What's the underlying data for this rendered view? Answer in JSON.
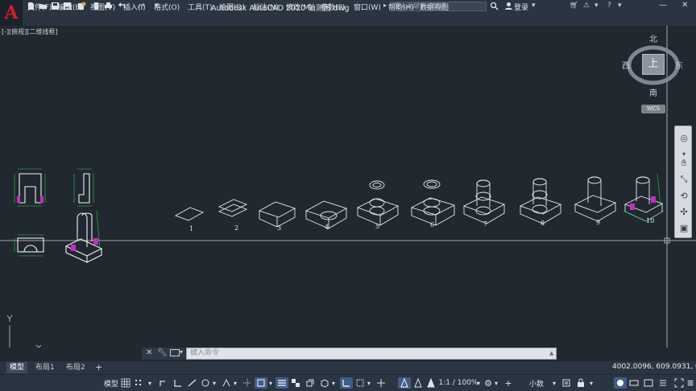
{
  "app": {
    "logo_letter": "A",
    "title": "Autodesk AutoCAD 2020    轴测图.dwg",
    "search_placeholder": "键入关键字或短语",
    "login": "登录"
  },
  "menu": [
    "文件(F)",
    "编辑(E)",
    "视图(V)",
    "插入(I)",
    "格式(O)",
    "工具(T)",
    "绘图(D)",
    "标注(N)",
    "修改(M)",
    "参数(P)",
    "窗口(W)",
    "帮助(H)",
    "数据视图"
  ],
  "viewport": {
    "label": "[-][俯视][二维线框]"
  },
  "viewcube": {
    "north": "北",
    "south": "南",
    "east": "东",
    "west": "西",
    "face": "上",
    "wcs": "WCS"
  },
  "steps": [
    "1",
    "2",
    "3",
    "4",
    "5",
    "6",
    "7",
    "8",
    "9",
    "10"
  ],
  "command": {
    "placeholder": "键入命令"
  },
  "tabs": [
    "模型",
    "布局1",
    "布局2"
  ],
  "coordinates": "4002.0096, 609.0931, 0.0000",
  "status": {
    "model": "模型",
    "scale": "1:1 / 100%",
    "units": "小数"
  },
  "colors": {
    "background": "#212830",
    "accent": "#3d5e88",
    "highlight": "#c030c0",
    "dimension": "#2ecc40"
  },
  "icons": [
    "new-icon",
    "open-icon",
    "save-icon",
    "saveas-icon",
    "web-icon",
    "plot-icon",
    "undo-icon",
    "redo-icon",
    "search-icon",
    "user-icon",
    "cart-icon",
    "exchange-icon",
    "help-icon",
    "minimize-icon",
    "close-icon"
  ]
}
